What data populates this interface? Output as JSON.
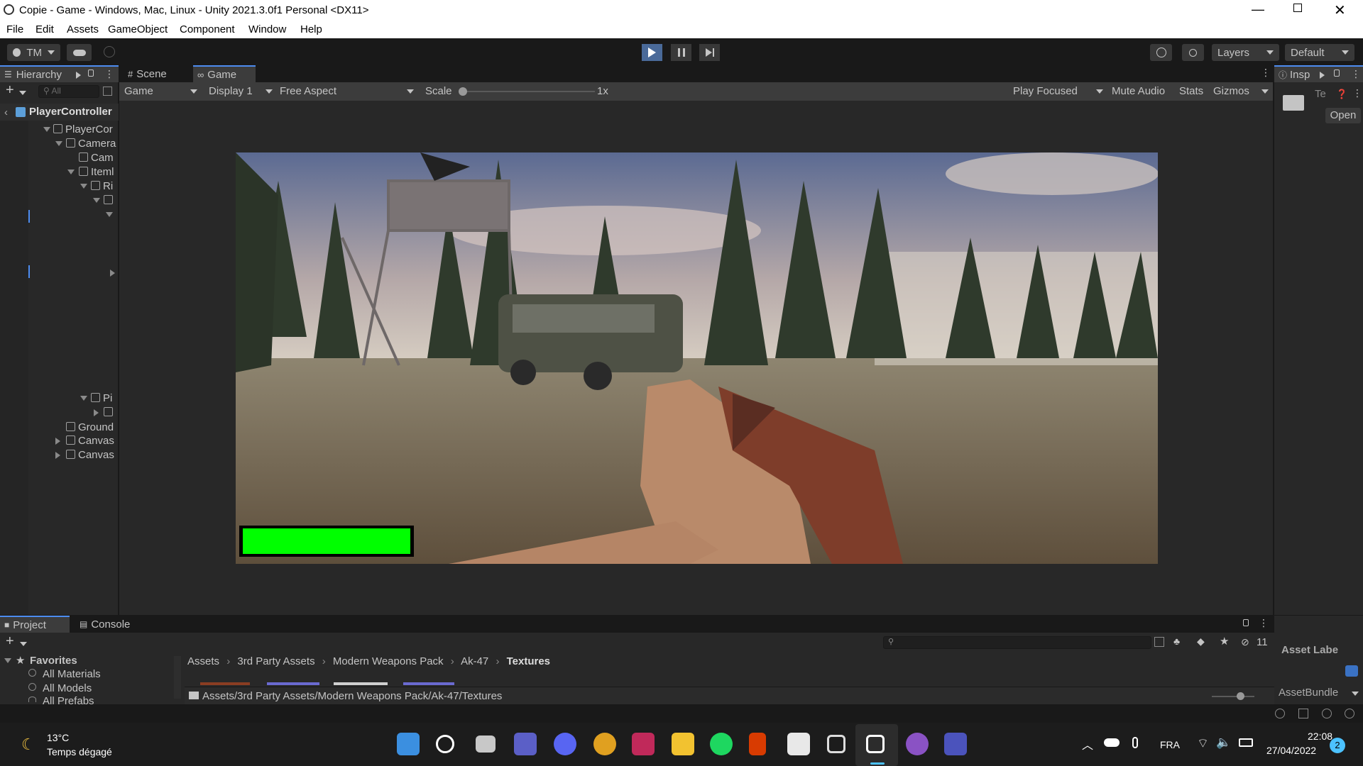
{
  "window": {
    "title": "Copie - Game - Windows, Mac, Linux - Unity 2021.3.0f1 Personal <DX11>"
  },
  "menu": [
    "File",
    "Edit",
    "Assets",
    "GameObject",
    "Component",
    "Window",
    "Help"
  ],
  "toolbar": {
    "account": "TM",
    "layers": "Layers",
    "layout": "Default"
  },
  "hierarchy": {
    "tab": "Hierarchy",
    "search_placeholder": "All",
    "scene": "PlayerController",
    "items": [
      {
        "label": "PlayerCor"
      },
      {
        "label": "Camera"
      },
      {
        "label": "Cam"
      },
      {
        "label": "Iteml"
      },
      {
        "label": "Ri"
      },
      {
        "label": ""
      },
      {
        "label": ""
      },
      {
        "label": "Pi"
      },
      {
        "label": ""
      },
      {
        "label": "Ground"
      },
      {
        "label": "Canvas"
      },
      {
        "label": "Canvas"
      }
    ]
  },
  "tabs": {
    "scene": "Scene",
    "game": "Game"
  },
  "gametoolbar": {
    "mode": "Game",
    "display": "Display 1",
    "aspect": "Free Aspect",
    "scale_label": "Scale",
    "scale_value": "1x",
    "play_focused": "Play Focused",
    "mute": "Mute Audio",
    "stats": "Stats",
    "gizmos": "Gizmos"
  },
  "game": {
    "health_fraction": 1.0,
    "health_color": "#00ff00"
  },
  "inspector": {
    "tab": "Insp",
    "te": "Te",
    "open": "Open",
    "asset_labels": "Asset Labe",
    "asset_bundle": "AssetBundle"
  },
  "project": {
    "tab_project": "Project",
    "tab_console": "Console",
    "favorites": "Favorites",
    "fav_items": [
      "All Materials",
      "All Models",
      "All Prefabs"
    ],
    "breadcrumb": [
      "Assets",
      "3rd Party Assets",
      "Modern Weapons Pack",
      "Ak-47",
      "Textures"
    ],
    "path": "Assets/3rd Party Assets/Modern Weapons Pack/Ak-47/Textures",
    "hidden_count": "11"
  },
  "taskbar": {
    "weather_temp": "13°C",
    "weather_desc": "Temps dégagé",
    "lang": "FRA",
    "time": "22:08",
    "date": "27/04/2022",
    "notif": "2"
  },
  "colors": {
    "accent": "#4d8cf0",
    "editor_bg": "#282828",
    "health_green": "#00ff00"
  }
}
